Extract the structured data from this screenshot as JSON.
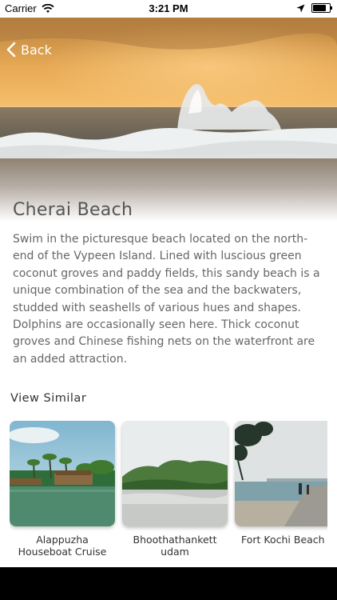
{
  "status_bar": {
    "carrier": "Carrier",
    "time": "3:21 PM",
    "battery_level": 0.9,
    "icons": [
      "wifi-icon",
      "location-arrow-icon",
      "battery-icon"
    ]
  },
  "header": {
    "back_label": "Back"
  },
  "detail": {
    "title": "Cherai Beach",
    "description": "Swim in the picturesque beach located on the north-end of the Vypeen Island. Lined with luscious green coconut groves and paddy fields, this sandy beach is a unique combination of the sea and the backwaters, studded with seashells of various hues and shapes. Dolphins are occasionally seen here. Thick coconut groves and Chinese fishing nets on the waterfront are an added attraction."
  },
  "similar": {
    "title": "View Similar",
    "items": [
      {
        "label": "Alappuzha\nHouseboat Cruise"
      },
      {
        "label": "Bhoothathankett\nudam"
      },
      {
        "label": "Fort Kochi Beach"
      }
    ]
  },
  "colors": {
    "sky_top": "#c98a3e",
    "sky_bottom": "#f4b868",
    "sea": "#6a655c",
    "foam": "#e9ecec"
  }
}
